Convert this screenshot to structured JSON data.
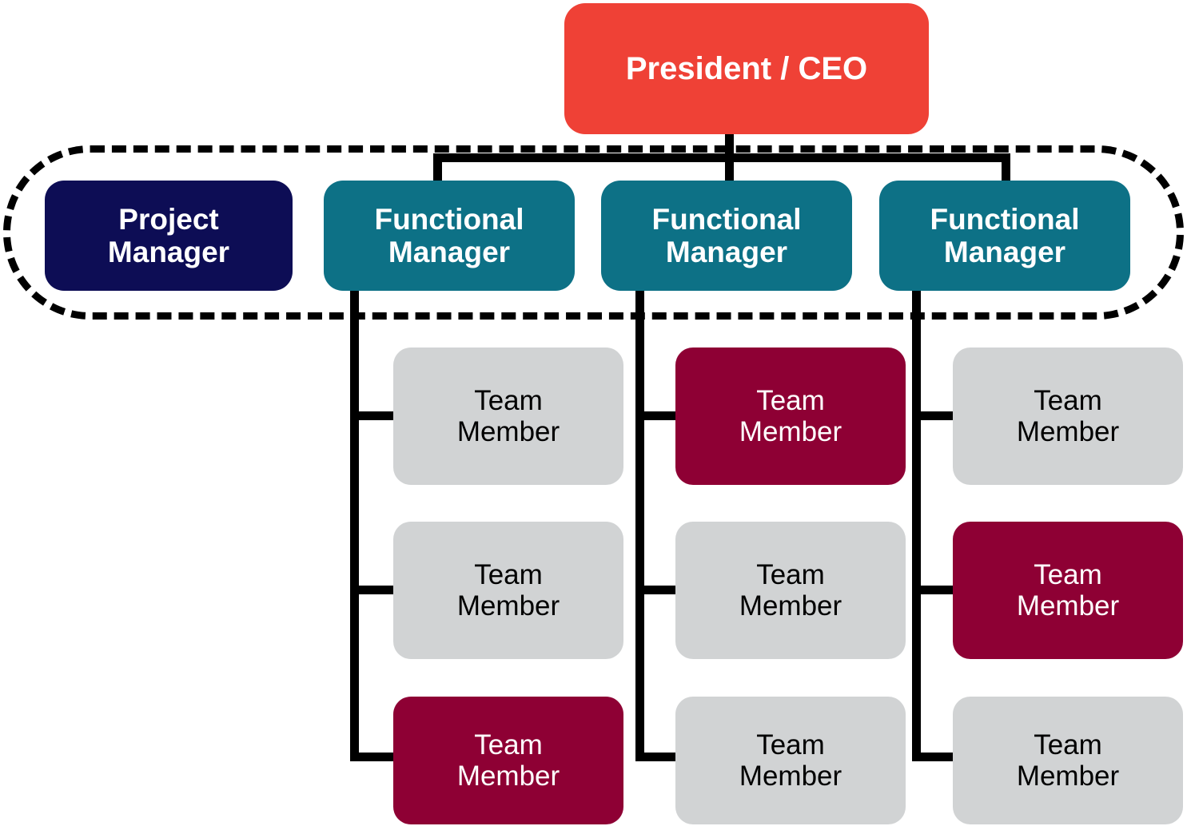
{
  "diagram": {
    "type": "organizational-chart",
    "title_present": false,
    "colors": {
      "ceo": "#ef4136",
      "project_manager": "#0d0d55",
      "functional_manager": "#0d7186",
      "team_member_inactive": "#d1d3d4",
      "team_member_highlighted": "#8e0034",
      "connector": "#000000",
      "highlight_region_border": "#000000",
      "background": "#ffffff"
    },
    "ceo": {
      "label": "President / CEO"
    },
    "project_manager": {
      "label": "Project\nManager"
    },
    "functional_managers": [
      {
        "label": "Functional\nManager"
      },
      {
        "label": "Functional\nManager"
      },
      {
        "label": "Functional\nManager"
      }
    ],
    "columns": [
      {
        "manager_index": 0,
        "team_members": [
          {
            "label": "Team\nMember",
            "state": "inactive"
          },
          {
            "label": "Team\nMember",
            "state": "inactive"
          },
          {
            "label": "Team\nMember",
            "state": "highlighted"
          }
        ]
      },
      {
        "manager_index": 1,
        "team_members": [
          {
            "label": "Team\nMember",
            "state": "highlighted"
          },
          {
            "label": "Team\nMember",
            "state": "inactive"
          },
          {
            "label": "Team\nMember",
            "state": "inactive"
          }
        ]
      },
      {
        "manager_index": 2,
        "team_members": [
          {
            "label": "Team\nMember",
            "state": "inactive"
          },
          {
            "label": "Team\nMember",
            "state": "highlighted"
          },
          {
            "label": "Team\nMember",
            "state": "inactive"
          }
        ]
      }
    ]
  }
}
